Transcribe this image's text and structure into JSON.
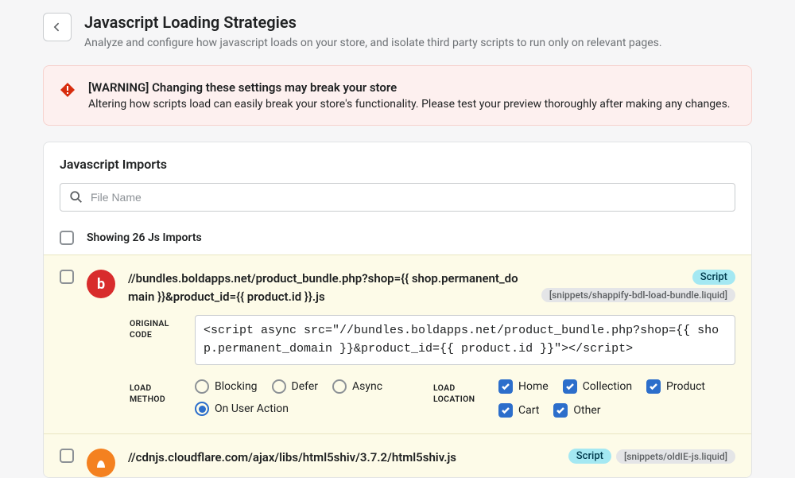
{
  "header": {
    "title": "Javascript Loading Strategies",
    "subtitle": "Analyze and configure how javascript loads on your store, and isolate third party scripts to run only on relevant pages."
  },
  "alert": {
    "title": "[WARNING] Changing these settings may break your store",
    "body": "Altering how scripts load can easily break your store's functionality. Please test your preview thoroughly after making any changes."
  },
  "card": {
    "title": "Javascript Imports",
    "search_placeholder": "File Name",
    "count_label": "Showing 26 Js Imports"
  },
  "labels": {
    "original_code": "ORIGINAL CODE",
    "load_method": "LOAD METHOD",
    "load_location": "LOAD LOCATION"
  },
  "load_methods": [
    "Blocking",
    "Defer",
    "Async",
    "On User Action"
  ],
  "load_locations": [
    "Home",
    "Collection",
    "Product",
    "Cart",
    "Other"
  ],
  "imports": [
    {
      "brand_letter": "b",
      "brand_color": "red",
      "title": "//bundles.boldapps.net/product_bundle.php?shop={{ shop.permanent_domain }}&product_id={{ product.id }}.js",
      "badge_type": "Script",
      "badge_file": "[snippets/shappify-bdl-load-bundle.liquid]",
      "original_code": "<script async src=\"//bundles.boldapps.net/product_bundle.php?shop={{ shop.permanent_domain }}&product_id={{ product.id }}\"></script>",
      "selected_method": "On User Action",
      "locations_checked": [
        "Home",
        "Collection",
        "Product",
        "Cart",
        "Other"
      ]
    },
    {
      "brand_letter": "",
      "brand_color": "orange",
      "title": "//cdnjs.cloudflare.com/ajax/libs/html5shiv/3.7.2/html5shiv.js",
      "badge_type": "Script",
      "badge_file": "[snippets/oldIE-js.liquid]"
    }
  ]
}
